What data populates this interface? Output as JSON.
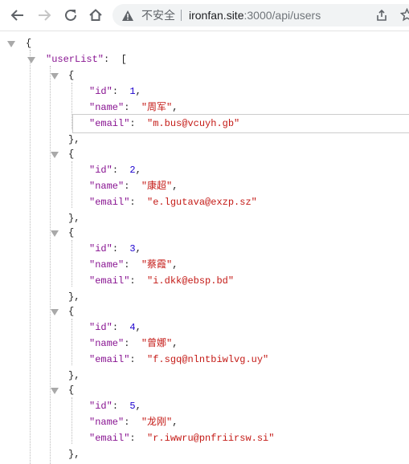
{
  "browser": {
    "security_label": "不安全",
    "url_host": "ironfan.site",
    "url_rest": ":3000/api/users"
  },
  "icons": [
    "back-arrow-icon",
    "forward-arrow-icon",
    "reload-icon",
    "home-icon",
    "warning-icon",
    "share-icon",
    "star-icon",
    "collapse-triangle-icon"
  ],
  "json": {
    "root_open": "{",
    "list_key": "\"userList\"",
    "colon": ":",
    "list_open": "[",
    "obj_open": "{",
    "obj_close": "},",
    "comma": ",",
    "keys": {
      "id": "\"id\"",
      "name": "\"name\"",
      "email": "\"email\""
    },
    "users": [
      {
        "id": "1",
        "name": "\"周军\"",
        "email": "\"m.bus@vcuyh.gb\""
      },
      {
        "id": "2",
        "name": "\"康超\"",
        "email": "\"e.lgutava@exzp.sz\""
      },
      {
        "id": "3",
        "name": "\"蔡霞\"",
        "email": "\"i.dkk@ebsp.bd\""
      },
      {
        "id": "4",
        "name": "\"曾娜\"",
        "email": "\"f.sgq@nlntbiwlvg.uy\""
      },
      {
        "id": "5",
        "name": "\"龙刚\"",
        "email": "\"r.iwwru@pnfriirsw.si\""
      }
    ]
  }
}
